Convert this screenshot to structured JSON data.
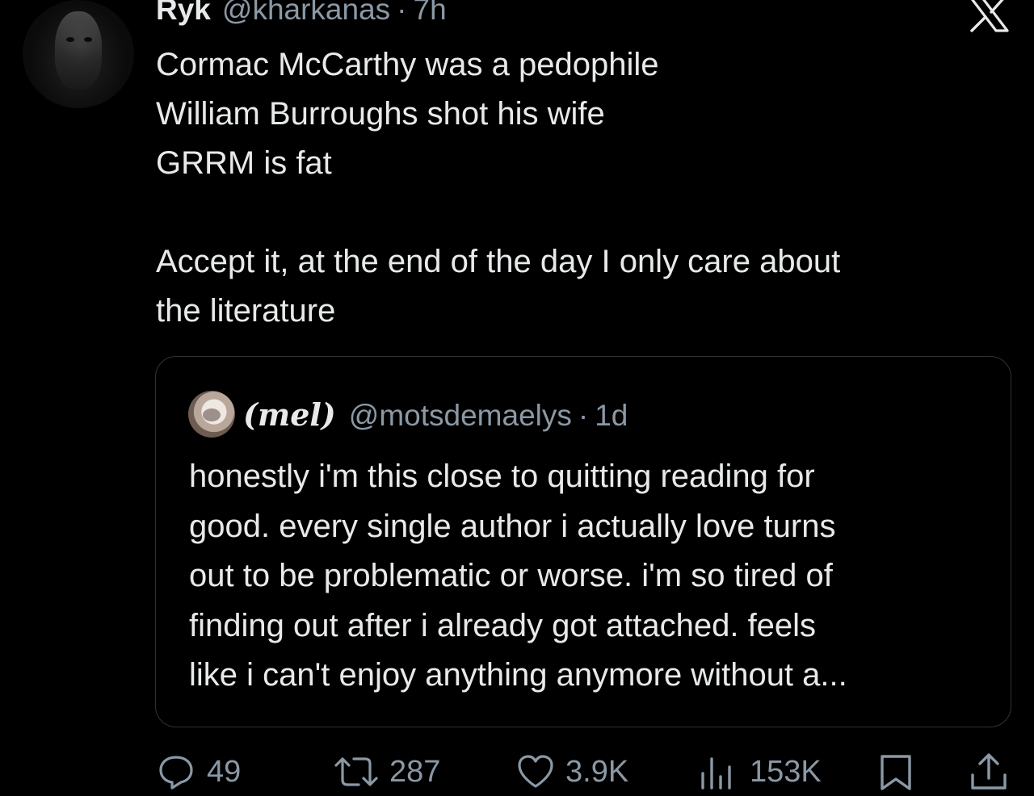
{
  "tweet": {
    "author": {
      "display_name": "Ryk",
      "handle": "@kharkanas",
      "separator": "·",
      "time": "7h",
      "avatar_icon": "author-avatar"
    },
    "lines": [
      "Cormac McCarthy was a pedophile",
      "William Burroughs shot his wife",
      "GRRM is fat",
      "",
      "Accept it, at the end of the day I only care about",
      "the literature"
    ]
  },
  "quoted_tweet": {
    "display_name": "(mel)",
    "handle": "@motsdemaelys",
    "separator": "·",
    "time": "1d",
    "lines": [
      "honestly i'm this close to quitting reading for",
      "good. every single author i actually love turns",
      "out to be problematic or worse. i'm so tired of",
      "finding out after i already got attached. feels",
      "like i can't enjoy anything anymore without a..."
    ]
  },
  "actions": {
    "reply": {
      "icon": "reply-icon",
      "count": "49"
    },
    "repost": {
      "icon": "repost-icon",
      "count": "287"
    },
    "like": {
      "icon": "heart-icon",
      "count": "3.9K"
    },
    "views": {
      "icon": "views-icon",
      "count": "153K"
    },
    "bookmark": {
      "icon": "bookmark-icon"
    },
    "share": {
      "icon": "share-icon"
    }
  },
  "brand": {
    "logo_icon": "x-logo-icon"
  },
  "colors": {
    "background": "#000000",
    "text_primary": "#e7e9ea",
    "text_secondary": "#8b98a5",
    "border": "#2f3336"
  }
}
